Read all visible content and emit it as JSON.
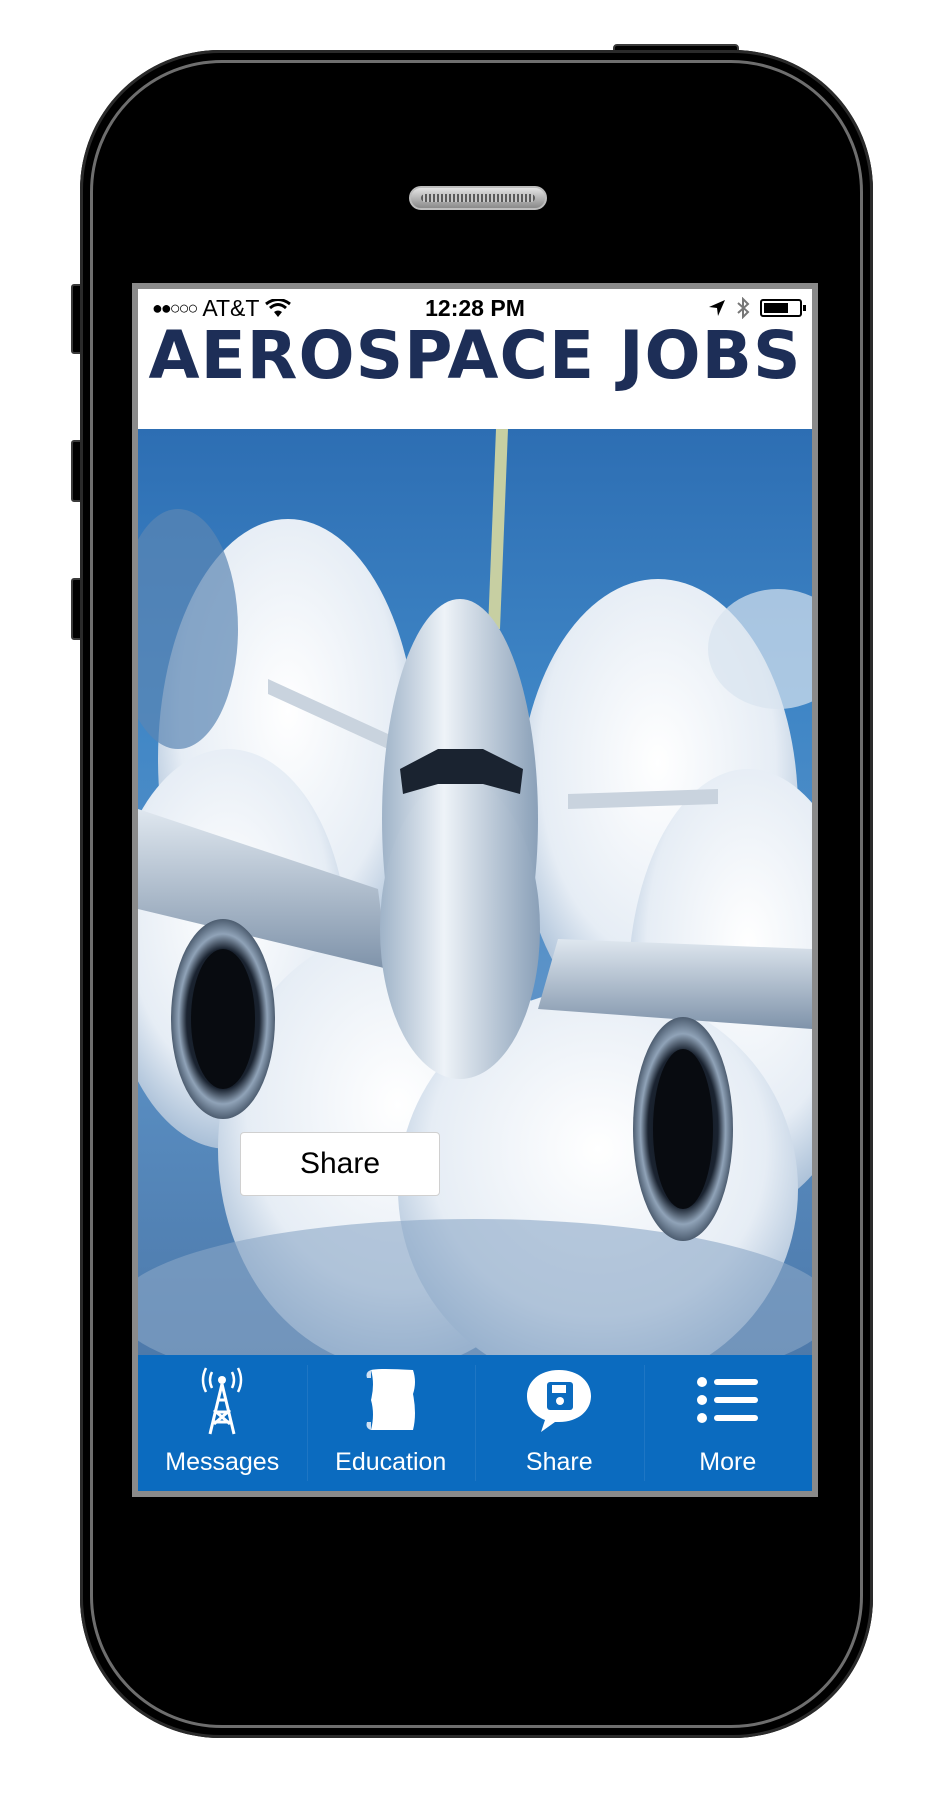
{
  "status_bar": {
    "signal": "●●○○○",
    "carrier": "AT&T",
    "time": "12:28 PM",
    "icons": [
      "wifi-icon",
      "location-arrow-icon",
      "bluetooth-icon",
      "battery-icon"
    ]
  },
  "header": {
    "title": "AEROSPACE JOBS",
    "title_color": "#1d2e57"
  },
  "hero": {
    "image": "airplane-in-clouds"
  },
  "share_overlay": {
    "label": "Share"
  },
  "tabbar": {
    "background": "#0b6bbf",
    "tabs": [
      {
        "label": "Messages",
        "icon": "radio-tower-icon"
      },
      {
        "label": "Education",
        "icon": "scroll-icon"
      },
      {
        "label": "Share",
        "icon": "share-disk-bubble-icon"
      },
      {
        "label": "More",
        "icon": "list-icon"
      }
    ]
  }
}
